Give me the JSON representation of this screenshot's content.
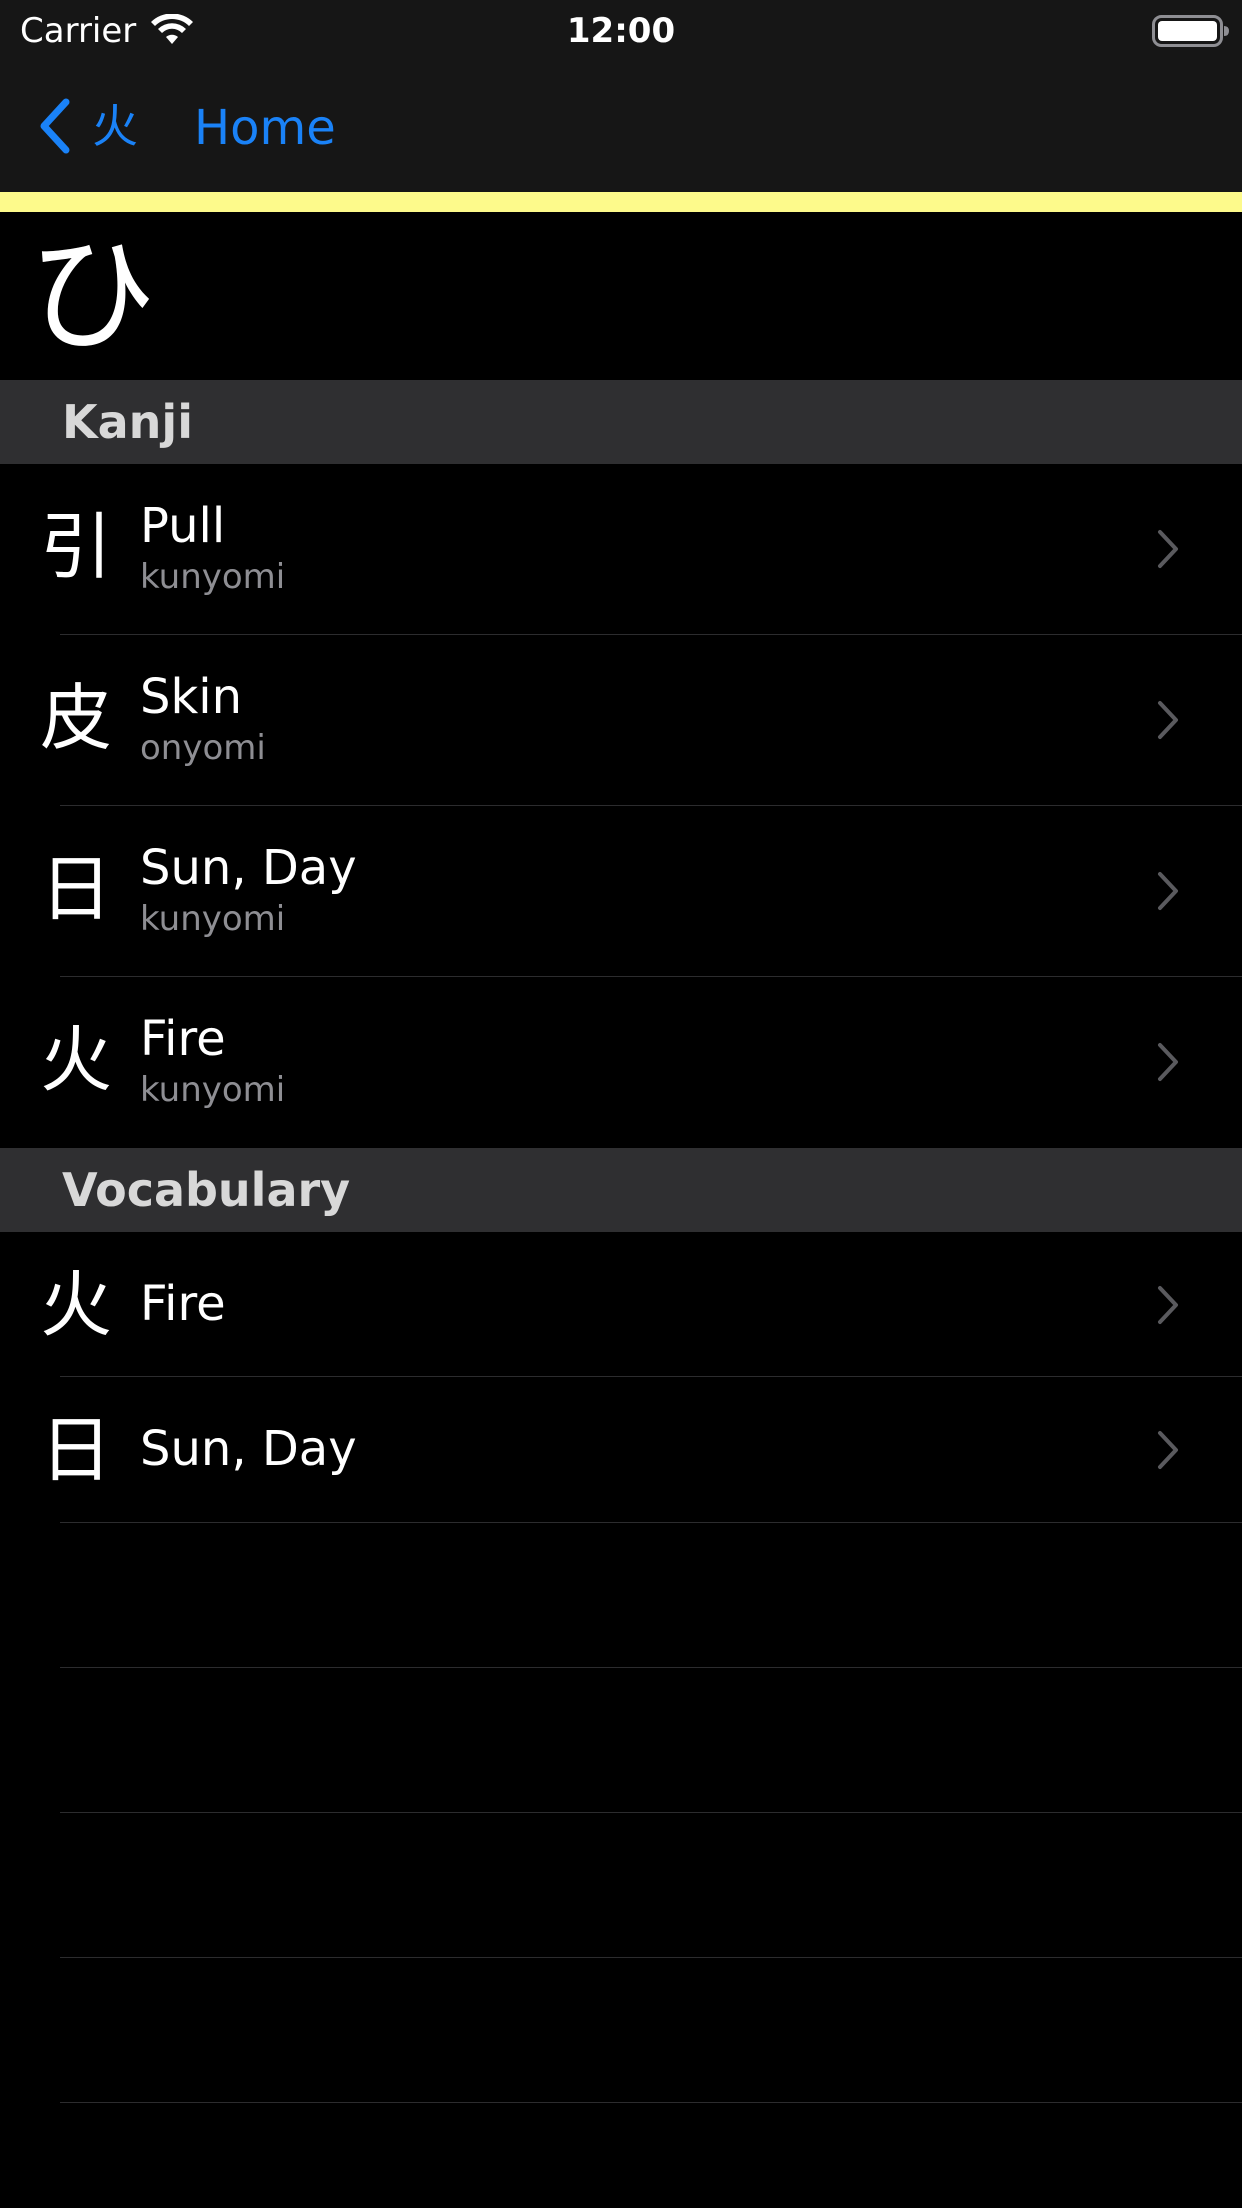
{
  "status_bar": {
    "carrier": "Carrier",
    "time": "12:00",
    "wifi_icon": "wifi-icon",
    "battery_icon": "battery-icon"
  },
  "nav": {
    "back_label": "火",
    "title": "Home",
    "back_icon": "chevron-left-icon"
  },
  "hero": {
    "character": "ひ",
    "strip_color": "#fdfa8b"
  },
  "sections": {
    "kanji": {
      "title": "Kanji",
      "accent_color": "#ff00a6",
      "items": [
        {
          "character": "引",
          "meaning": "Pull",
          "reading": "kunyomi"
        },
        {
          "character": "皮",
          "meaning": "Skin",
          "reading": "onyomi"
        },
        {
          "character": "日",
          "meaning": "Sun, Day",
          "reading": "kunyomi"
        },
        {
          "character": "火",
          "meaning": "Fire",
          "reading": "kunyomi"
        }
      ]
    },
    "vocabulary": {
      "title": "Vocabulary",
      "accent_color": "#a100ff",
      "items": [
        {
          "character": "火",
          "meaning": "Fire"
        },
        {
          "character": "日",
          "meaning": "Sun, Day"
        }
      ]
    }
  },
  "colors": {
    "tint": "#1a82f7",
    "background": "#000000",
    "bar_background": "#161616",
    "section_header": "#2f2f31"
  }
}
